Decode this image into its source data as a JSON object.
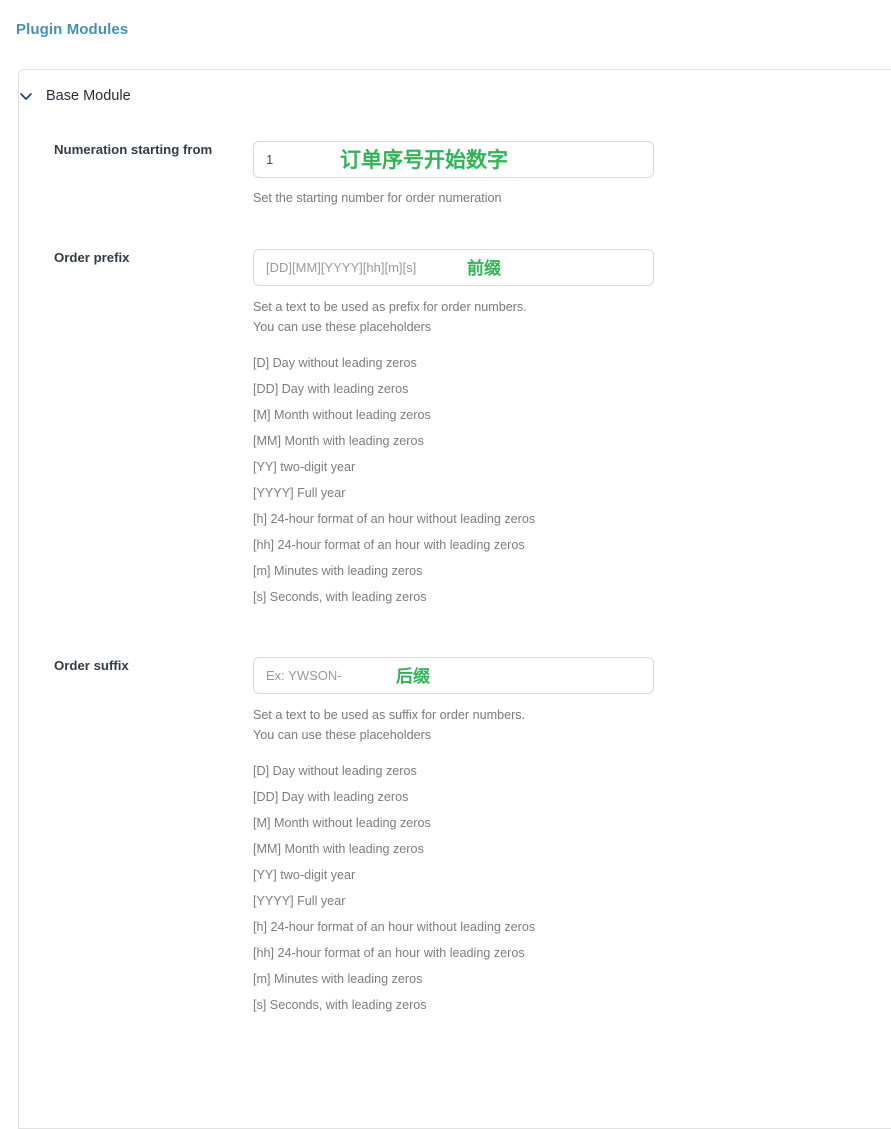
{
  "header": {
    "title": "Plugin Modules"
  },
  "module": {
    "title": "Base Module",
    "chevron_icon": "chevron-down-icon",
    "expanded": true
  },
  "placeholders": [
    "[D] Day without leading zeros",
    "[DD] Day with leading zeros",
    "[M] Month without leading zeros",
    "[MM] Month with leading zeros",
    "[YY] two-digit year",
    "[YYYY] Full year",
    "[h] 24-hour format of an hour without leading zeros",
    "[hh] 24-hour format of an hour with leading zeros",
    "[m] Minutes with leading zeros",
    "[s] Seconds, with leading zeros"
  ],
  "fields": {
    "numeration": {
      "label": "Numeration starting from",
      "value": "1",
      "placeholder": "1",
      "help": "Set the starting number for order numeration",
      "annotation": "订单序号开始数字"
    },
    "prefix": {
      "label": "Order prefix",
      "value": "",
      "placeholder": "[DD][MM][YYYY][hh][m][s]",
      "help_line1": "Set a text to be used as prefix for order numbers.",
      "help_line2": "You can use these placeholders",
      "annotation": "前缀"
    },
    "suffix": {
      "label": "Order suffix",
      "value": "",
      "placeholder": "Ex: YWSON-",
      "help_line1": "Set a text to be used as suffix for order numbers.",
      "help_line2": "You can use these placeholders",
      "annotation": "后缀"
    }
  },
  "colors": {
    "title_blue": "#4292b5",
    "annotation_green": "#2fb457",
    "label_dark": "#333c45",
    "help_gray": "#7a7a7a",
    "border_gray": "#e2e2e2",
    "input_border": "#d9d9d9"
  }
}
